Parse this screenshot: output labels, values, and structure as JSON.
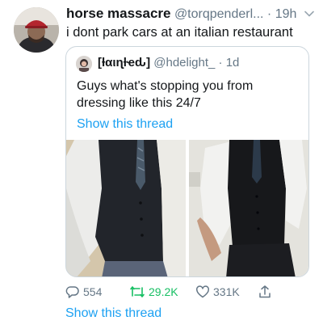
{
  "tweet": {
    "display_name": "horse massacre",
    "handle": "@torqpenderl...",
    "separator": "·",
    "time": "19h",
    "text": "i dont park cars at an italian restaurant"
  },
  "quoted": {
    "display_name": "[ƚαιɳƚҽԃ]",
    "handle": "@hdelight_",
    "separator": "·",
    "time": "1d",
    "text": "Guys what's stopping you from dressing like this 24/7",
    "show_thread": "Show this thread"
  },
  "actions": {
    "replies": "554",
    "retweets": "29.2K",
    "likes": "331K"
  },
  "show_thread": "Show this thread",
  "colors": {
    "link": "#1da1f2",
    "retweet_active": "#17bf63",
    "muted": "#657786",
    "border": "#ccd6dd"
  },
  "icons": {
    "reply": "reply-icon",
    "retweet": "retweet-icon",
    "like": "heart-icon",
    "share": "share-icon",
    "menu": "chevron-down-icon"
  }
}
